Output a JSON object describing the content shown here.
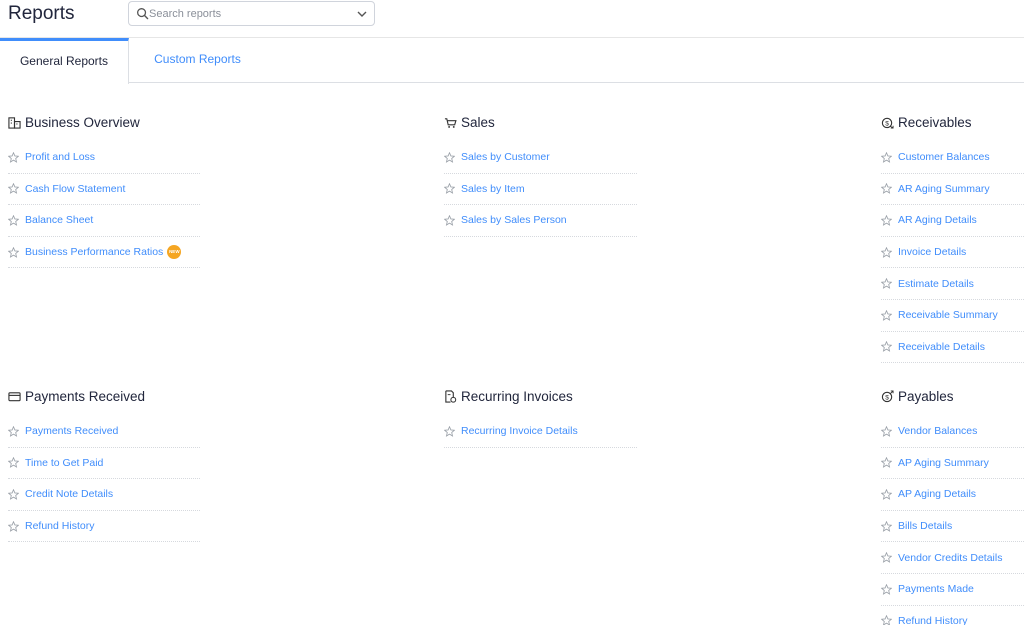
{
  "header": {
    "title": "Reports",
    "search": {
      "placeholder": "Search reports",
      "value": ""
    }
  },
  "tabs": [
    {
      "label": "General Reports",
      "active": true
    },
    {
      "label": "Custom Reports",
      "active": false
    }
  ],
  "sections": {
    "business_overview": {
      "title": "Business Overview",
      "icon": "building-icon",
      "items": [
        {
          "label": "Profit and Loss"
        },
        {
          "label": "Cash Flow Statement"
        },
        {
          "label": "Balance Sheet"
        },
        {
          "label": "Business Performance Ratios",
          "badge": "NEW"
        }
      ]
    },
    "sales": {
      "title": "Sales",
      "icon": "cart-icon",
      "items": [
        {
          "label": "Sales by Customer"
        },
        {
          "label": "Sales by Item"
        },
        {
          "label": "Sales by Sales Person"
        }
      ]
    },
    "receivables": {
      "title": "Receivables",
      "icon": "coin-in-icon",
      "items": [
        {
          "label": "Customer Balances"
        },
        {
          "label": "AR Aging Summary"
        },
        {
          "label": "AR Aging Details"
        },
        {
          "label": "Invoice Details"
        },
        {
          "label": "Estimate Details"
        },
        {
          "label": "Receivable Summary"
        },
        {
          "label": "Receivable Details"
        }
      ]
    },
    "payments_received": {
      "title": "Payments Received",
      "icon": "card-icon",
      "items": [
        {
          "label": "Payments Received"
        },
        {
          "label": "Time to Get Paid"
        },
        {
          "label": "Credit Note Details"
        },
        {
          "label": "Refund History"
        }
      ]
    },
    "recurring_invoices": {
      "title": "Recurring Invoices",
      "icon": "recurring-doc-icon",
      "items": [
        {
          "label": "Recurring Invoice Details"
        }
      ]
    },
    "payables": {
      "title": "Payables",
      "icon": "coin-out-icon",
      "items": [
        {
          "label": "Vendor Balances"
        },
        {
          "label": "AP Aging Summary"
        },
        {
          "label": "AP Aging Details"
        },
        {
          "label": "Bills Details"
        },
        {
          "label": "Vendor Credits Details"
        },
        {
          "label": "Payments Made"
        },
        {
          "label": "Refund History"
        }
      ]
    }
  },
  "colors": {
    "accent": "#408dfb",
    "badge": "#f5a623",
    "title": "#21263c"
  }
}
